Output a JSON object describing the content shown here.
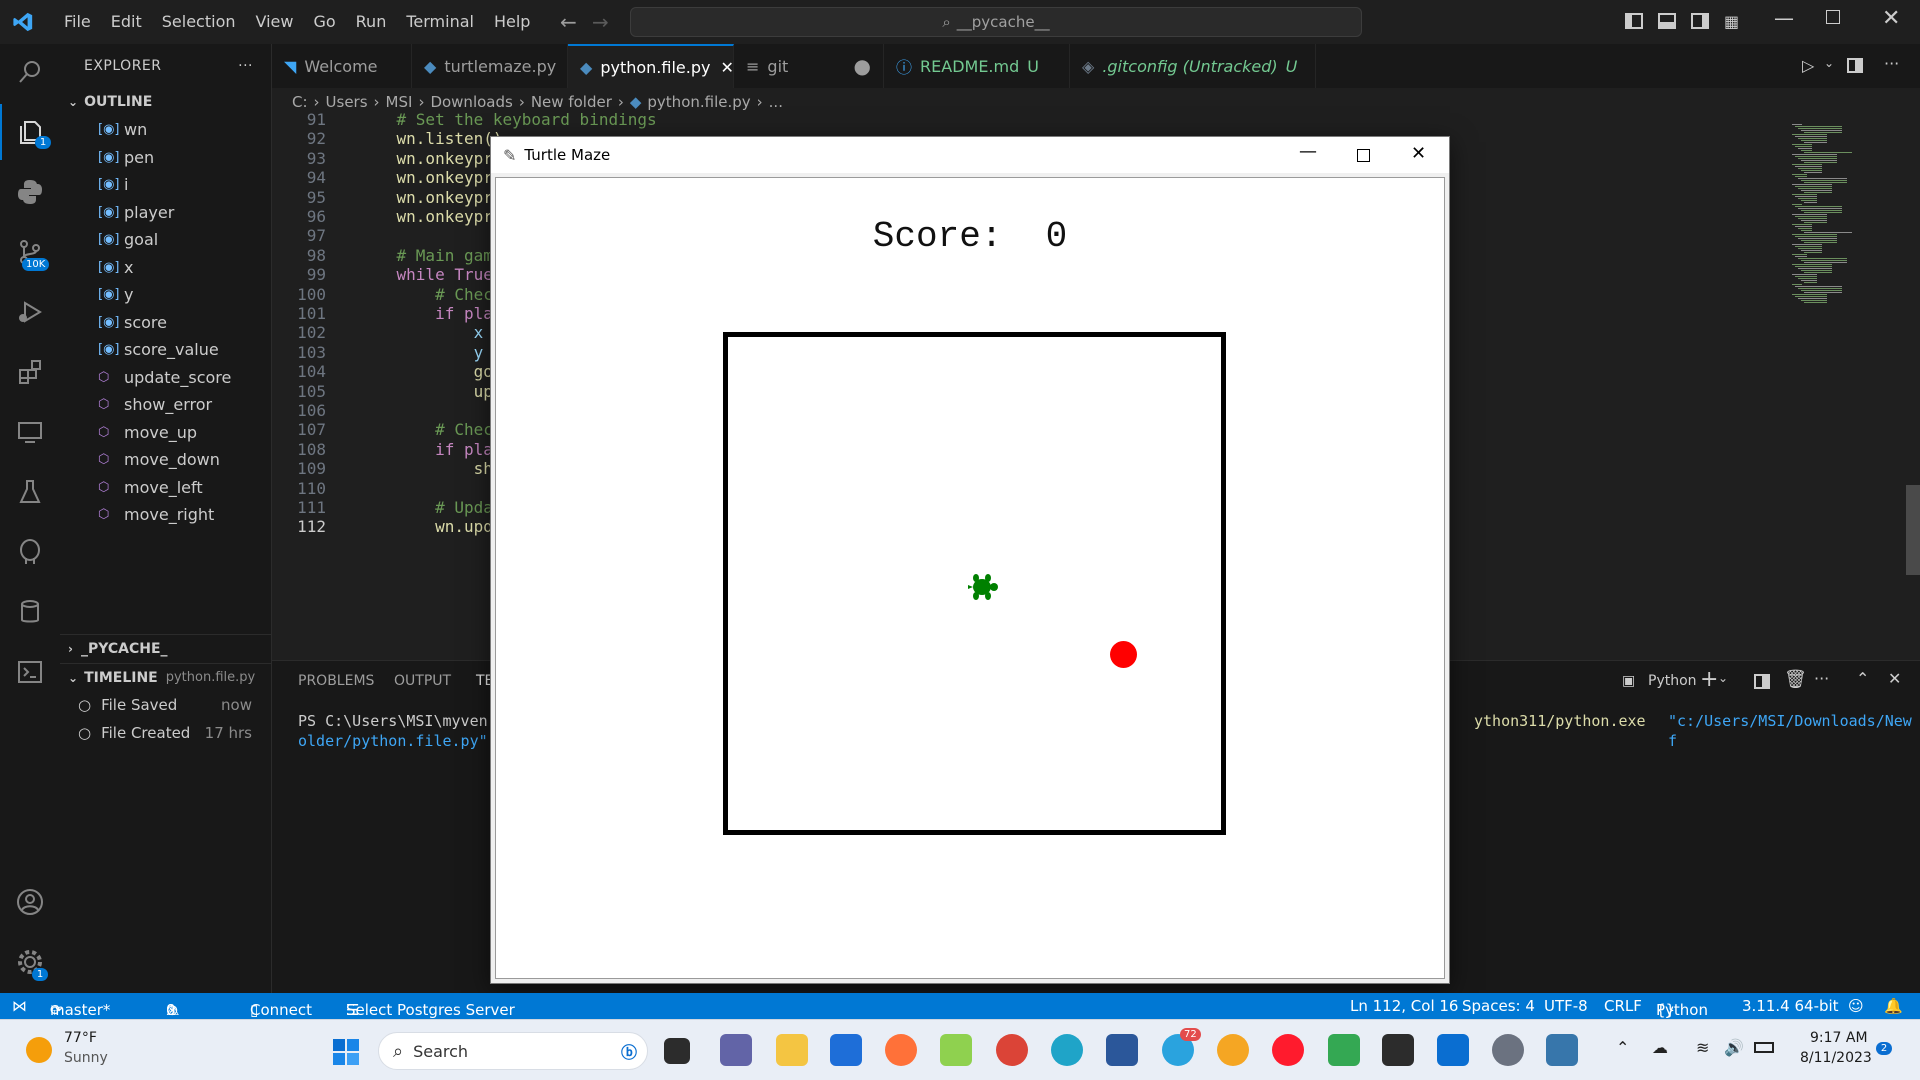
{
  "menu": [
    "File",
    "Edit",
    "Selection",
    "View",
    "Go",
    "Run",
    "Terminal",
    "Help"
  ],
  "search": {
    "text": "__pycache__"
  },
  "sidebar": {
    "title": "EXPLORER",
    "outline_label": "OUTLINE",
    "outline": [
      {
        "label": "wn",
        "kind": "variable"
      },
      {
        "label": "pen",
        "kind": "variable"
      },
      {
        "label": "i",
        "kind": "variable"
      },
      {
        "label": "player",
        "kind": "variable"
      },
      {
        "label": "goal",
        "kind": "variable"
      },
      {
        "label": "x",
        "kind": "variable"
      },
      {
        "label": "y",
        "kind": "variable"
      },
      {
        "label": "score",
        "kind": "variable"
      },
      {
        "label": "score_value",
        "kind": "variable"
      },
      {
        "label": "update_score",
        "kind": "method"
      },
      {
        "label": "show_error",
        "kind": "method"
      },
      {
        "label": "move_up",
        "kind": "method"
      },
      {
        "label": "move_down",
        "kind": "method"
      },
      {
        "label": "move_left",
        "kind": "method"
      },
      {
        "label": "move_right",
        "kind": "method"
      }
    ],
    "pycache_label": "_PYCACHE_",
    "timeline_label": "TIMELINE",
    "timeline_file": "python.file.py",
    "timeline": [
      {
        "label": "File Saved",
        "time": "now"
      },
      {
        "label": "File Created",
        "time": "17 hrs"
      }
    ]
  },
  "activity_badges": {
    "explorer": "1",
    "source_control": "10K",
    "settings": "1"
  },
  "tabs": [
    {
      "label": "Welcome"
    },
    {
      "label": "turtlemaze.py"
    },
    {
      "label": "python.file.py",
      "active": true
    },
    {
      "label": "git"
    },
    {
      "label": "README.md",
      "status": "U"
    },
    {
      "label": ".gitconfig (Untracked)",
      "status": "U"
    }
  ],
  "breadcrumb": [
    "C:",
    "Users",
    "MSI",
    "Downloads",
    "New folder",
    "python.file.py",
    "..."
  ],
  "editor": {
    "line_numbers": [
      "91",
      "92",
      "93",
      "94",
      "95",
      "96",
      "97",
      "98",
      "99",
      "100",
      "101",
      "102",
      "103",
      "104",
      "105",
      "106",
      "107",
      "108",
      "109",
      "110",
      "111",
      "112"
    ],
    "lines": [
      "    # Set the keyboard bindings",
      "    wn.listen()",
      "    wn.onkeypress(",
      "    wn.onkeypress(",
      "    wn.onkeypress(",
      "    wn.onkeypress(",
      "",
      "    # Main game lo",
      "    while True:",
      "        # Check if",
      "        if player.",
      "            x = ra",
      "            y = ra",
      "            goal.g",
      "            update",
      "",
      "        # Check fo",
      "        if player.",
      "            show_e",
      "",
      "        # Update t",
      "        wn.update("
    ]
  },
  "panel": {
    "tabs": [
      "PROBLEMS",
      "OUTPUT",
      "TE"
    ],
    "terminal_profile": "Python",
    "terminal_line1_left": "PS C:\\Users\\MSI\\myven",
    "terminal_line1_right_exe": "ython311/python.exe",
    "terminal_line1_right_path": "\"c:/Users/MSI/Downloads/New f",
    "terminal_line2": "older/python.file.py\""
  },
  "turtle_window": {
    "title": "Turtle Maze",
    "score_text": "Score:  0"
  },
  "statusbar": {
    "branch": "master*",
    "errors": "0",
    "warnings": "0",
    "connect": "Connect",
    "postgres": "Select Postgres Server",
    "position": "Ln 112, Col 16",
    "spaces": "Spaces: 4",
    "encoding": "UTF-8",
    "eol": "CRLF",
    "language": "Python",
    "interpreter": "3.11.4 64-bit"
  },
  "taskbar": {
    "temp": "77°F",
    "weather": "Sunny",
    "search": "Search",
    "time": "9:17 AM",
    "date": "8/11/2023",
    "telegram_badge": "72",
    "notif": "2"
  },
  "colors": {
    "accent": "#0078d4",
    "goal": "#ff0000",
    "turtle": "#008000"
  }
}
